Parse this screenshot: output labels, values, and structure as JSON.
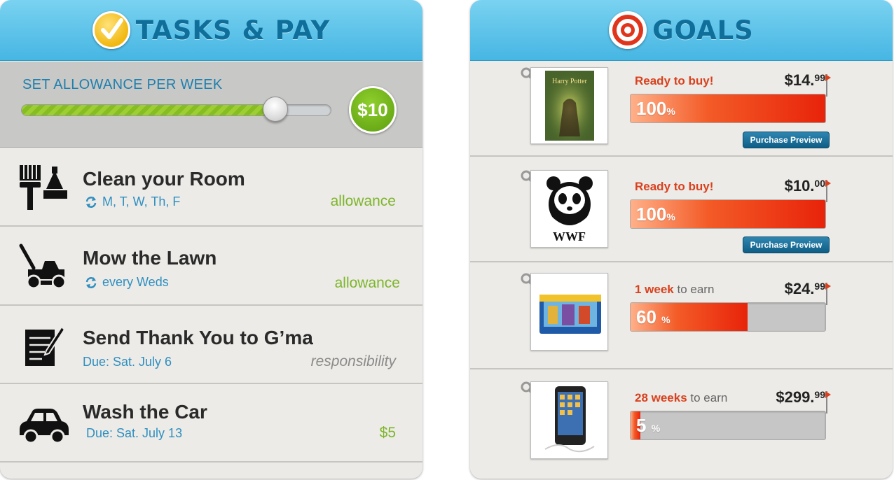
{
  "tasks_panel": {
    "title": "TASKS & PAY",
    "allowance": {
      "label": "SET ALLOWANCE PER WEEK",
      "value_fraction": 0.82,
      "amount": "$10"
    },
    "tasks": [
      {
        "title": "Clean your Room",
        "schedule": "M, T, W, Th, F",
        "tag": "allowance",
        "tag_color": "#7db52a",
        "recurring": true,
        "icon": "broom-dustpan-icon"
      },
      {
        "title": "Mow the Lawn",
        "schedule": "every Weds",
        "tag": "allowance",
        "tag_color": "#7db52a",
        "recurring": true,
        "icon": "lawn-mower-icon"
      },
      {
        "title": "Send Thank You to G’ma",
        "schedule": "Due: Sat. July 6",
        "tag": "responsibility",
        "tag_color": "#8a8a8a",
        "recurring": false,
        "icon": "letter-icon"
      },
      {
        "title": "Wash the Car",
        "schedule": "Due: Sat. July 13",
        "tag": "$5",
        "tag_color": "#7db52a",
        "recurring": false,
        "icon": "car-icon"
      }
    ]
  },
  "goals_panel": {
    "title": "GOALS",
    "goals": [
      {
        "status_strong": "Ready to buy!",
        "status_rest": "",
        "price_main": "$14.",
        "price_cents": "99",
        "percent": 100,
        "percent_label": "100",
        "button": "Purchase Preview",
        "thumb": "book-cover-image"
      },
      {
        "status_strong": "Ready to buy!",
        "status_rest": "",
        "price_main": "$10.",
        "price_cents": "00",
        "percent": 100,
        "percent_label": "100",
        "button": "Purchase Preview",
        "thumb": "wwf-panda-logo"
      },
      {
        "status_strong": "1 week",
        "status_rest": " to earn",
        "price_main": "$24.",
        "price_cents": "99",
        "percent": 60,
        "percent_label": "60",
        "button": "",
        "thumb": "toy-box-image"
      },
      {
        "status_strong": "28 weeks",
        "status_rest": " to earn",
        "price_main": "$299.",
        "price_cents": "99",
        "percent": 5,
        "percent_label": "5",
        "button": "",
        "thumb": "music-player-image"
      }
    ],
    "wwf_text": "WWF"
  },
  "colors": {
    "header_blue": "#46b6e3",
    "title_blue": "#0f6f9a",
    "allowance_green": "#7db52a",
    "progress_orange": "#f35b27",
    "status_red": "#d9411e"
  }
}
